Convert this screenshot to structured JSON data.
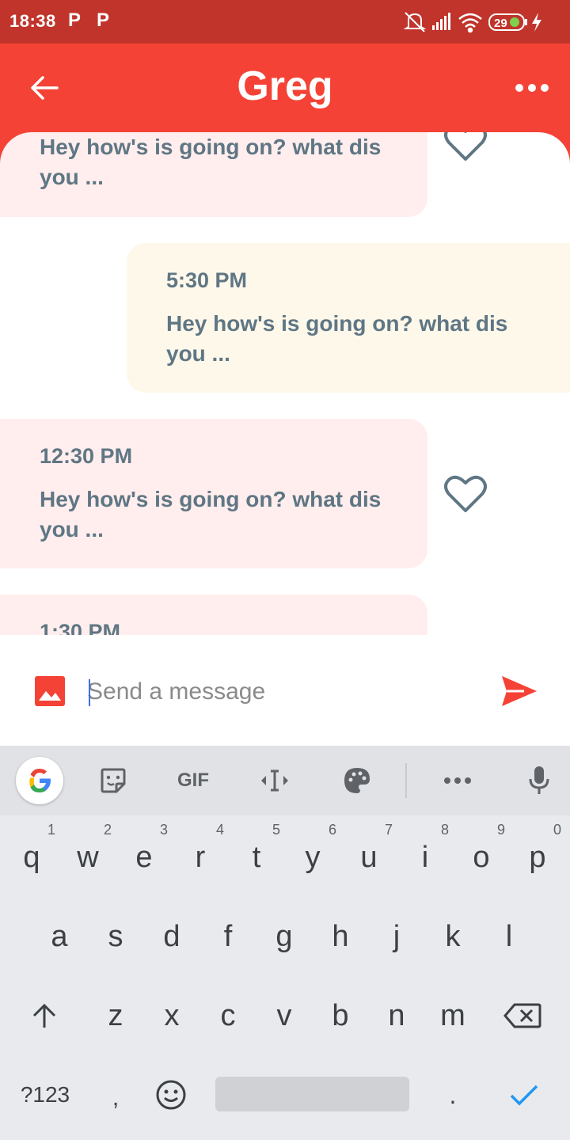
{
  "status_bar": {
    "time": "18:38",
    "notification_icons": [
      "P",
      "P"
    ],
    "battery_level": "29"
  },
  "app_bar": {
    "title": "Greg",
    "background_color": "#f44336"
  },
  "messages": [
    {
      "direction": "received",
      "time": "",
      "text": "Hey how's is going on? what dis you ...",
      "has_heart": true
    },
    {
      "direction": "sent",
      "time": "5:30 PM",
      "text": "Hey how's is going on? what dis you ...",
      "has_heart": false
    },
    {
      "direction": "received",
      "time": "12:30 PM",
      "text": "Hey how's is going on? what dis you ...",
      "has_heart": true
    },
    {
      "direction": "received",
      "time": "1:30 PM",
      "text": "",
      "has_heart": false
    }
  ],
  "composer": {
    "placeholder": "Send a message",
    "accent_color": "#f44336"
  },
  "keyboard": {
    "toolbar": {
      "gif_label": "GIF"
    },
    "rows": [
      [
        {
          "char": "q",
          "hint": "1"
        },
        {
          "char": "w",
          "hint": "2"
        },
        {
          "char": "e",
          "hint": "3"
        },
        {
          "char": "r",
          "hint": "4"
        },
        {
          "char": "t",
          "hint": "5"
        },
        {
          "char": "y",
          "hint": "6"
        },
        {
          "char": "u",
          "hint": "7"
        },
        {
          "char": "i",
          "hint": "8"
        },
        {
          "char": "o",
          "hint": "9"
        },
        {
          "char": "p",
          "hint": "0"
        }
      ],
      [
        "a",
        "s",
        "d",
        "f",
        "g",
        "h",
        "j",
        "k",
        "l"
      ],
      [
        "z",
        "x",
        "c",
        "v",
        "b",
        "n",
        "m"
      ]
    ],
    "symbols_label": "?123",
    "comma_label": ",",
    "period_label": ".",
    "accent_color": "#2196f3"
  }
}
